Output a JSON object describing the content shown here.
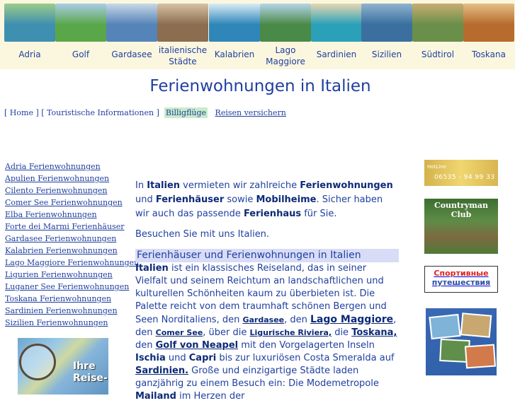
{
  "nav": [
    {
      "label": "Adria",
      "icon": "adria-thumbnail",
      "color": "#3f8fb0",
      "color2": "#9ccc8a"
    },
    {
      "label": "Golf",
      "icon": "golf-thumbnail",
      "color": "#5aa74a",
      "color2": "#a9cde8"
    },
    {
      "label": "Gardasee",
      "icon": "gardasee-thumbnail",
      "color": "#5584b8",
      "color2": "#c9d8e6"
    },
    {
      "label": "italienische Städte",
      "icon": "staedte-thumbnail",
      "color": "#8c6d50",
      "color2": "#d6c3a4"
    },
    {
      "label": "Kalabrien",
      "icon": "kalabrien-thumbnail",
      "color": "#2f86b8",
      "color2": "#d9ecf6"
    },
    {
      "label": "Lago Maggiore",
      "icon": "lago-maggiore-thumbnail",
      "color": "#4a8a48",
      "color2": "#b5d5ea"
    },
    {
      "label": "Sardinien",
      "icon": "sardinien-thumbnail",
      "color": "#2aa1b8",
      "color2": "#e7d7b2"
    },
    {
      "label": "Sizilien",
      "icon": "sizilien-thumbnail",
      "color": "#3a6f9f",
      "color2": "#8fb3cf"
    },
    {
      "label": "Südtirol",
      "icon": "suedtirol-thumbnail",
      "color": "#6a8f4a",
      "color2": "#c8ad72"
    },
    {
      "label": "Toskana",
      "icon": "toskana-thumbnail",
      "color": "#b86b2e",
      "color2": "#e2c084"
    }
  ],
  "page_title": "Ferienwohnungen in Italien",
  "breadcrumb": {
    "home": "Home",
    "tourist_info": "Touristische Informationen",
    "flights": "Billigflüge",
    "insurance": "Reisen versichern"
  },
  "left_links": [
    "Adria Ferienwohnungen",
    "Apulien Ferienwohnungen",
    "Cilento Ferienwohnungen",
    "Comer See Ferienwohnungen",
    "Elba Ferienwohnungen",
    "Forte dei Marmi Ferienhäuser",
    "Gardasee Ferienwohnungen",
    "Kalabrien Ferienwohnungen",
    "Lago Maggiore Ferienwohnungen",
    "Ligurien Ferienwohnungen",
    "Luganer See Ferienwohnungen",
    "Toskana Ferienwohnungen",
    "Sardinien Ferienwohnungen",
    "Sizilien Ferienwohnungen"
  ],
  "map_ad": {
    "line1": "Ihre",
    "line2": "Reise-"
  },
  "intro": {
    "t1": "In ",
    "b1": "Italien",
    "t2": " vermieten wir zahlreiche ",
    "b2": "Ferienwohnungen",
    "t3": " und ",
    "b3": "Ferienhäuser",
    "t4": " sowie ",
    "b4": "Mobilheime",
    "t5": ".  Sicher haben wir auch das passende ",
    "b5": "Ferienhaus",
    "t6": " für Sie."
  },
  "visit_text": "Besuchen Sie mit uns Italien.",
  "section_heading": "Ferienhäuser und Ferienwohnungen in Italien",
  "body": {
    "b1": "Italien",
    "t1": " ist ein klassisches Reiseland, das in seiner Vielfalt und seinem Reichtum an landschaftlichen und kulturellen Schönheiten kaum zu überbieten ist. Die Palette reicht von dem traumhaft schönen Bergen und Seen Norditaliens, den ",
    "l1": "Gardasee",
    "t2": ", den ",
    "l2": "Lago Maggiore",
    "t3": ", den ",
    "l3": "Comer See",
    "t4": ", über die ",
    "l4": "Ligurische Riviera,",
    "t5": " die ",
    "l5": "Toskana,",
    "t6": " den ",
    "l6": "Golf von Neapel",
    "t7": " mit den Vorgelagerten Inseln ",
    "b2": "Ischia",
    "t8": " und ",
    "b3": "Capri",
    "t9": " bis zur luxuriösen Costa Smeralda auf ",
    "l7": "Sardinien.",
    "t10": " Große und einzigartige Städte laden ganzjährig zu einem Besuch ein: Die Modemetropole ",
    "b4": "Mailand",
    "t11": " im Herzen der"
  },
  "ads": {
    "hotline_title": "HotLine",
    "hotline_number": "06535 - 94 99 33",
    "country_club": "Countryman Club",
    "sport_line1": "Спортивные",
    "sport_line2": "путешествия"
  }
}
